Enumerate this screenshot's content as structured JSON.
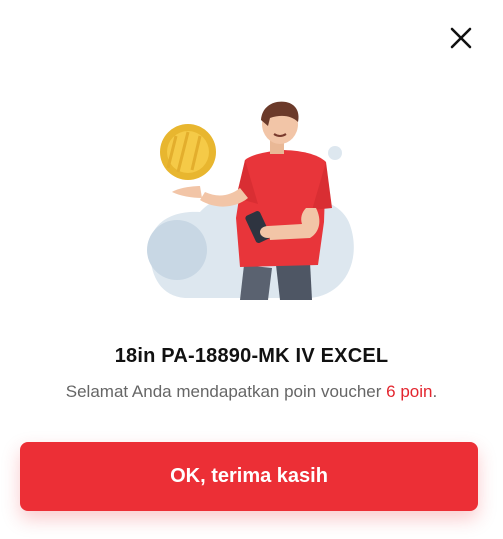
{
  "modal": {
    "title": "18in PA-18890-MK IV EXCEL",
    "message_prefix": "Selamat Anda mendapatkan poin voucher",
    "points_text": "6 poin",
    "message_suffix": ".",
    "ok_button_label": "OK, terima kasih",
    "close_icon": "close-icon",
    "illustration_icon": "person-coin-illustration"
  },
  "colors": {
    "accent": "#EC2F36",
    "points_text": "#E3262F",
    "title": "#111111",
    "message": "#666666"
  }
}
